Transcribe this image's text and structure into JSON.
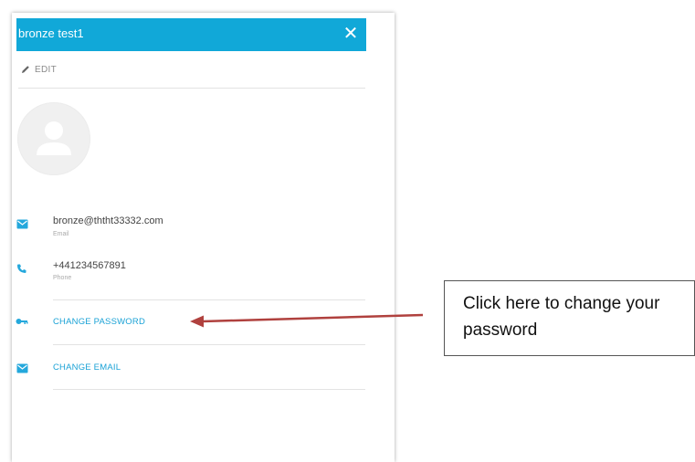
{
  "dialog": {
    "title": "bronze test1",
    "close_glyph": "✕",
    "edit_label": "EDIT",
    "accent_color": "#11a8d8",
    "link_color": "#1aa2d6"
  },
  "contact": {
    "email": {
      "value": "bronze@ththt33332.com",
      "label": "Email",
      "icon": "email-icon"
    },
    "phone": {
      "value": "+441234567891",
      "label": "Phone",
      "icon": "phone-icon"
    }
  },
  "actions": {
    "change_password": {
      "label": "CHANGE PASSWORD",
      "icon": "key-icon"
    },
    "change_email": {
      "label": "CHANGE EMAIL",
      "icon": "email-icon"
    }
  },
  "annotation": {
    "text": "Click here to change your password",
    "arrow_color": "#b0413e"
  }
}
